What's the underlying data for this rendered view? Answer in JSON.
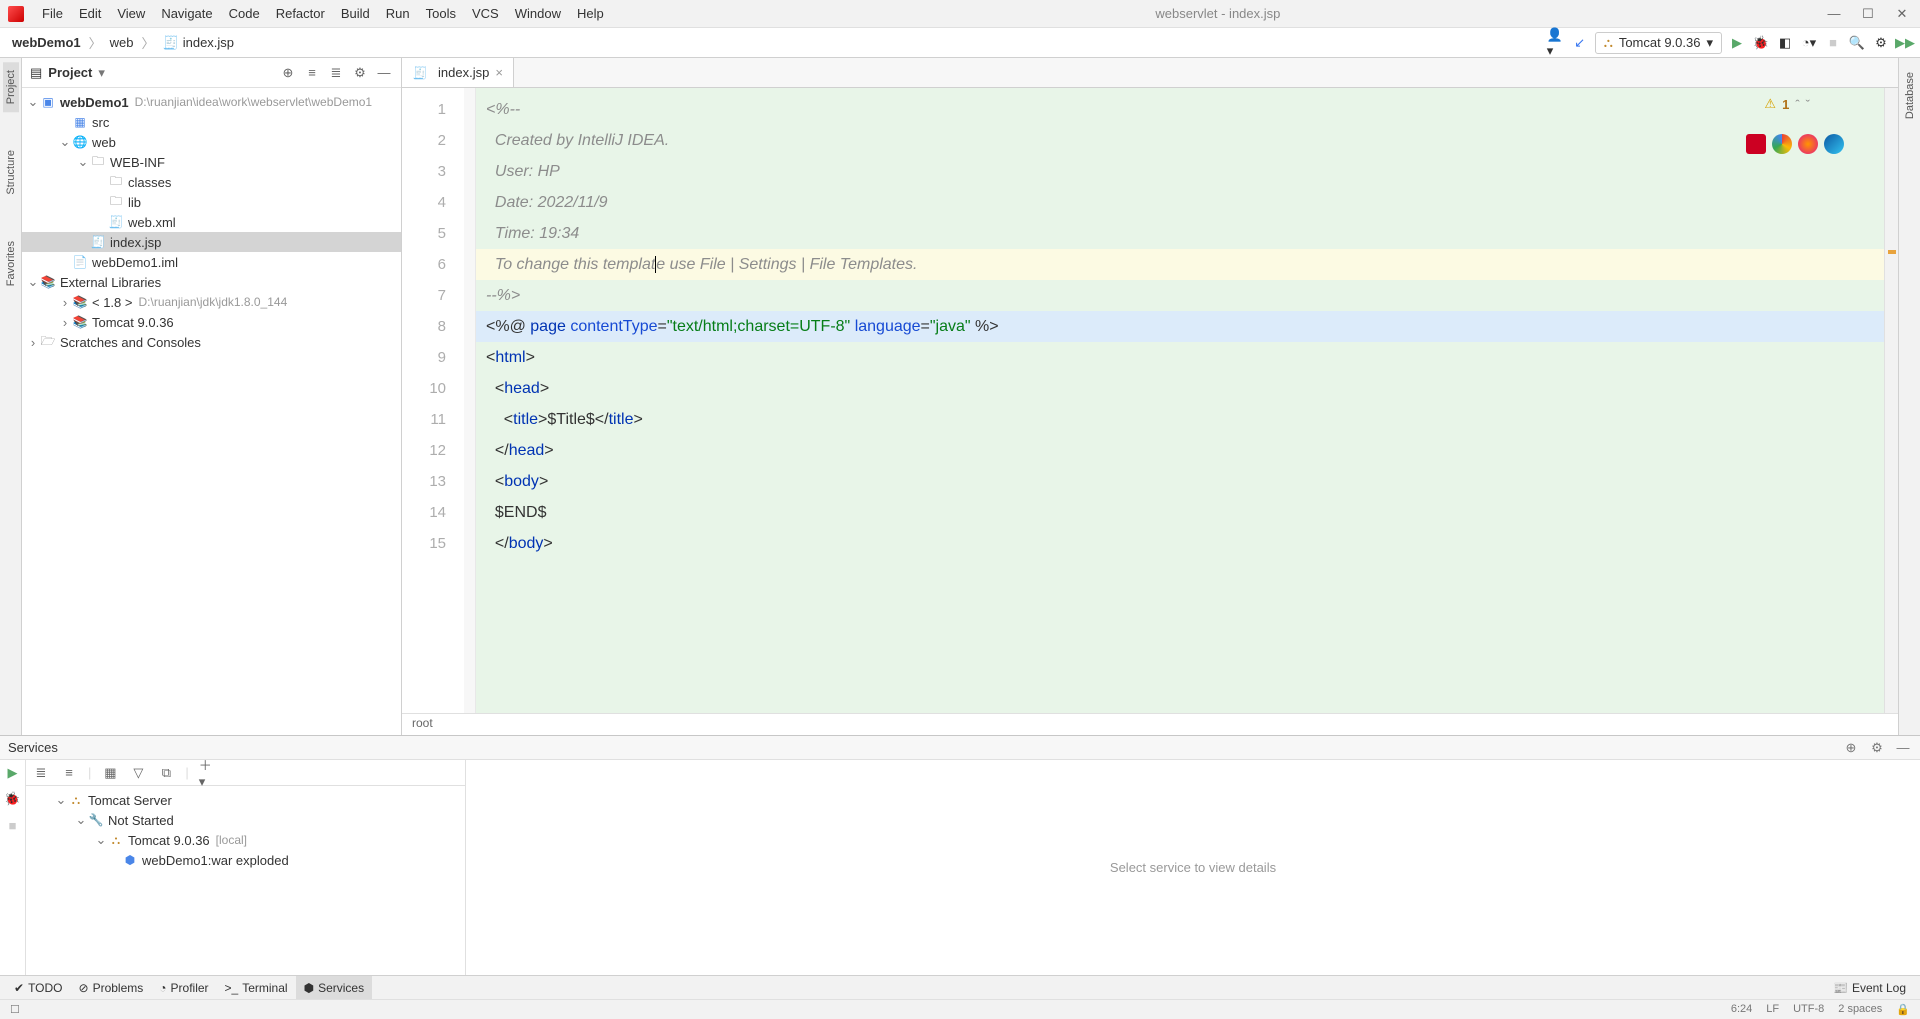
{
  "menubar": [
    "File",
    "Edit",
    "View",
    "Navigate",
    "Code",
    "Refactor",
    "Build",
    "Run",
    "Tools",
    "VCS",
    "Window",
    "Help"
  ],
  "window_title": "webservlet - index.jsp",
  "breadcrumbs": [
    "webDemo1",
    "web",
    "index.jsp"
  ],
  "run_config": {
    "label": "Tomcat 9.0.36"
  },
  "project_pane": {
    "title": "Project",
    "root": {
      "name": "webDemo1",
      "path": "D:\\ruanjian\\idea\\work\\webservlet\\webDemo1"
    },
    "tree": {
      "src": "src",
      "web": "web",
      "webinf": "WEB-INF",
      "classes": "classes",
      "lib": "lib",
      "webxml": "web.xml",
      "indexjsp": "index.jsp",
      "iml": "webDemo1.iml",
      "extlib": "External Libraries",
      "jdk_label": "< 1.8 >",
      "jdk_path": "D:\\ruanjian\\jdk\\jdk1.8.0_144",
      "tomcat": "Tomcat 9.0.36",
      "scratches": "Scratches and Consoles"
    }
  },
  "editor": {
    "tab": "index.jsp",
    "warning_count": "1",
    "breadcrumb": "root",
    "lines": [
      {
        "n": "1",
        "type": "cmt",
        "text": "<%--"
      },
      {
        "n": "2",
        "type": "cmt",
        "text": "  Created by IntelliJ IDEA."
      },
      {
        "n": "3",
        "type": "cmt",
        "text": "  User: HP"
      },
      {
        "n": "4",
        "type": "cmt",
        "text": "  Date: 2022/11/9"
      },
      {
        "n": "5",
        "type": "cmt",
        "text": "  Time: 19:34"
      },
      {
        "n": "6",
        "type": "cmt_hl",
        "text": "  To change this template use File | Settings | File Templates."
      },
      {
        "n": "7",
        "type": "cmt",
        "text": "--%>"
      },
      {
        "n": "8",
        "type": "page"
      },
      {
        "n": "9",
        "type": "tag",
        "text": "<html>"
      },
      {
        "n": "10",
        "type": "tag",
        "text": "<head>",
        "indent": 1
      },
      {
        "n": "11",
        "type": "title",
        "indent": 2
      },
      {
        "n": "12",
        "type": "tag",
        "text": "</head>",
        "indent": 1
      },
      {
        "n": "13",
        "type": "tag",
        "text": "<body>",
        "indent": 1
      },
      {
        "n": "14",
        "type": "plain",
        "text": "$END$",
        "indent": 1
      },
      {
        "n": "15",
        "type": "tag",
        "text": "</body>",
        "indent": 1
      }
    ],
    "title_placeholder": "$Title$"
  },
  "services": {
    "title": "Services",
    "details_placeholder": "Select service to view details",
    "tree": {
      "root": "Tomcat Server",
      "not_started": "Not Started",
      "config": "Tomcat 9.0.36",
      "config_suffix": "[local]",
      "artifact": "webDemo1:war exploded"
    }
  },
  "bottom_tabs": [
    "TODO",
    "Problems",
    "Profiler",
    "Terminal",
    "Services"
  ],
  "event_log": "Event Log",
  "status": {
    "pos": "6:24",
    "line_sep": "LF",
    "encoding": "UTF-8",
    "indent": "2 spaces"
  },
  "left_rail": [
    "Project",
    "Structure",
    "Favorites"
  ],
  "right_rail": [
    "Database"
  ]
}
